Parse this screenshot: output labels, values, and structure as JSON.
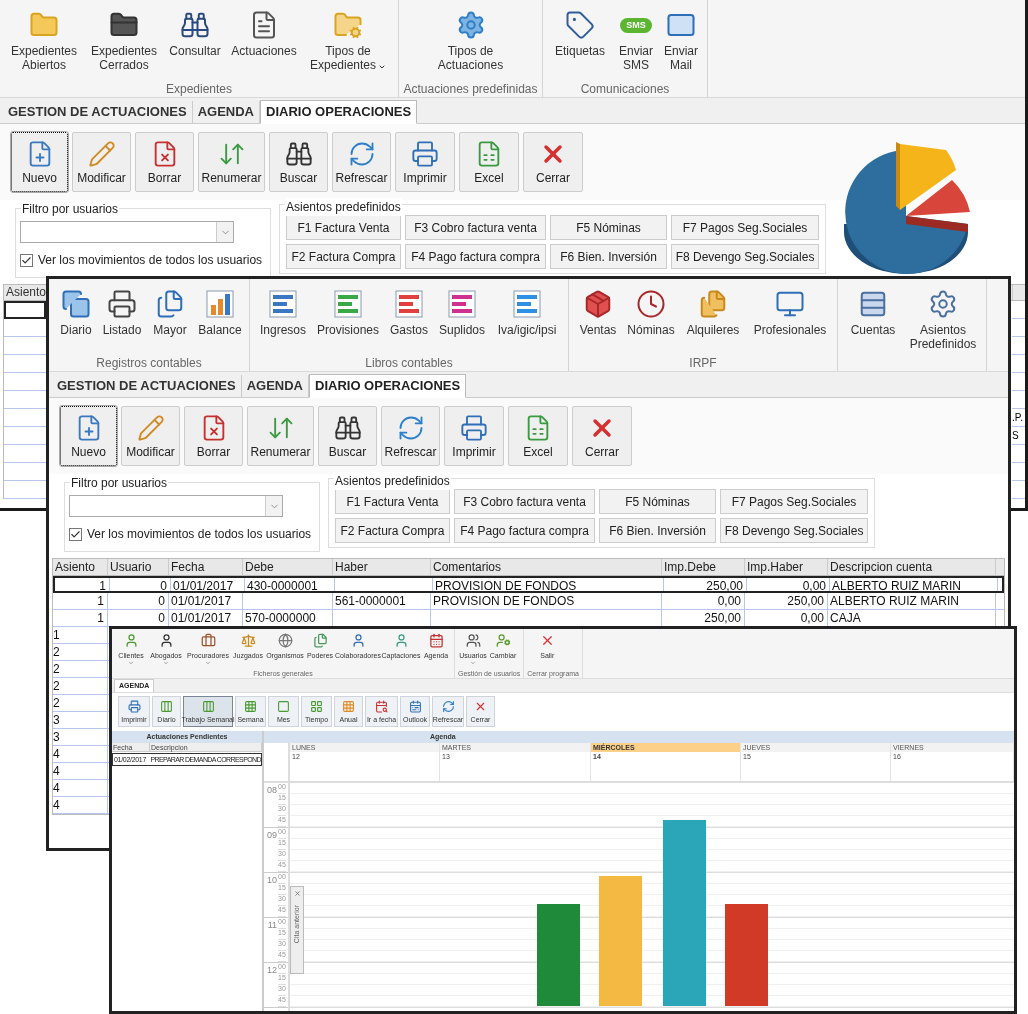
{
  "main_window": {
    "ribbon_groups": [
      {
        "label": "Expedientes",
        "buttons": [
          {
            "lines": [
              "Expedientes",
              "Abiertos"
            ],
            "dropdown": false
          },
          {
            "lines": [
              "Expedientes",
              "Cerrados"
            ],
            "dropdown": false
          },
          {
            "lines": [
              "Consultar"
            ],
            "dropdown": false
          },
          {
            "lines": [
              "Actuaciones"
            ],
            "dropdown": false
          },
          {
            "lines": [
              "Tipos de",
              "Expedientes"
            ],
            "dropdown": true
          }
        ]
      },
      {
        "label": "Actuaciones predefinidas",
        "buttons": [
          {
            "lines": [
              "Tipos de",
              "Actuaciones"
            ],
            "dropdown": false
          }
        ]
      },
      {
        "label": "Comunicaciones",
        "buttons": [
          {
            "lines": [
              "Etiquetas"
            ],
            "dropdown": false
          },
          {
            "lines": [
              "Enviar",
              "SMS"
            ],
            "dropdown": false,
            "icon_text": "SMS"
          },
          {
            "lines": [
              "Enviar",
              "Mail"
            ],
            "dropdown": false
          }
        ]
      }
    ],
    "tabs": [
      {
        "label": "GESTION DE ACTUACIONES",
        "selected": false
      },
      {
        "label": "AGENDA",
        "selected": false
      },
      {
        "label": "DIARIO OPERACIONES",
        "selected": true
      }
    ],
    "toolbar": [
      {
        "label": "Nuevo",
        "focused": true
      },
      {
        "label": "Modificar",
        "focused": false
      },
      {
        "label": "Borrar",
        "focused": false
      },
      {
        "label": "Renumerar",
        "focused": false
      },
      {
        "label": "Buscar",
        "focused": false
      },
      {
        "label": "Refrescar",
        "focused": false
      },
      {
        "label": "Imprimir",
        "focused": false
      },
      {
        "label": "Excel",
        "focused": false
      },
      {
        "label": "Cerrar",
        "focused": false
      }
    ],
    "user_filter": {
      "legend": "Filtro por usuarios",
      "checkbox": {
        "label": "Ver los movimientos de todos los usuarios",
        "checked": true
      }
    },
    "preset_entries": {
      "legend": "Asientos predefinidos",
      "buttons": [
        "F1 Factura Venta",
        "F3 Cobro factura venta",
        "F5 Nóminas",
        "F7 Pagos Seg.Sociales",
        "F2 Factura Compra",
        "F4 Pago factura compra",
        "F6 Bien. Inversión",
        "F8 Devengo Seg.Sociales"
      ]
    },
    "table": {
      "header": "Asiento",
      "rows": [
        {
          "selected": true
        },
        {
          "selected": false
        },
        {
          "selected": false
        },
        {
          "selected": false
        },
        {
          "selected": false
        },
        {
          "selected": false
        },
        {
          "selected": false,
          "edge_text": ".P."
        },
        {
          "selected": false,
          "edge_text": "S"
        },
        {
          "selected": false
        },
        {
          "selected": false
        },
        {
          "selected": false
        }
      ]
    }
  },
  "accounting_window": {
    "ribbon_groups": [
      {
        "label": "Registros contables",
        "buttons": [
          {
            "lines": [
              "Diario"
            ]
          },
          {
            "lines": [
              "Listado"
            ]
          },
          {
            "lines": [
              "Mayor"
            ]
          },
          {
            "lines": [
              "Balance"
            ]
          }
        ]
      },
      {
        "label": "Libros contables",
        "buttons": [
          {
            "lines": [
              "Ingresos"
            ]
          },
          {
            "lines": [
              "Provisiones"
            ]
          },
          {
            "lines": [
              "Gastos"
            ]
          },
          {
            "lines": [
              "Suplidos"
            ]
          },
          {
            "lines": [
              "Iva/igic/ipsi"
            ]
          }
        ]
      },
      {
        "label": "IRPF",
        "buttons": [
          {
            "lines": [
              "Ventas"
            ]
          },
          {
            "lines": [
              "Nóminas"
            ]
          },
          {
            "lines": [
              "Alquileres"
            ]
          },
          {
            "lines": [
              "Profesionales"
            ]
          }
        ]
      },
      {
        "buttons": [
          {
            "lines": [
              "Cuentas"
            ]
          },
          {
            "lines": [
              "Asientos",
              "Predefinidos"
            ]
          }
        ]
      }
    ],
    "tabs": [
      {
        "label": "GESTION DE ACTUACIONES",
        "selected": false
      },
      {
        "label": "AGENDA",
        "selected": false
      },
      {
        "label": "DIARIO OPERACIONES",
        "selected": true
      }
    ],
    "toolbar": [
      {
        "label": "Nuevo",
        "focused": true
      },
      {
        "label": "Modificar",
        "focused": false
      },
      {
        "label": "Borrar",
        "focused": false
      },
      {
        "label": "Renumerar",
        "focused": false
      },
      {
        "label": "Buscar",
        "focused": false
      },
      {
        "label": "Refrescar",
        "focused": false
      },
      {
        "label": "Imprimir",
        "focused": false
      },
      {
        "label": "Excel",
        "focused": false
      },
      {
        "label": "Cerrar",
        "focused": false
      }
    ],
    "user_filter": {
      "legend": "Filtro por usuarios",
      "checkbox": {
        "label": "Ver los movimientos de todos los usuarios",
        "checked": true
      }
    },
    "preset_entries": {
      "legend": "Asientos predefinidos",
      "buttons": [
        "F1 Factura Venta",
        "F3 Cobro factura venta",
        "F5 Nóminas",
        "F7 Pagos Seg.Sociales",
        "F2 Factura Compra",
        "F4 Pago factura compra",
        "F6 Bien. Inversión",
        "F8 Devengo Seg.Sociales"
      ]
    },
    "table": {
      "columns": [
        "Asiento",
        "Usuario",
        "Fecha",
        "Debe",
        "Haber",
        "Comentarios",
        "Imp.Debe",
        "Imp.Haber",
        "Descripcion cuenta"
      ],
      "rows": [
        {
          "selected": true,
          "cells": [
            "1",
            "0",
            "01/01/2017",
            "430-0000001",
            null,
            "PROVISION DE FONDOS",
            "250,00",
            "0,00",
            "ALBERTO RUIZ MARIN"
          ]
        },
        {
          "selected": false,
          "cells": [
            "1",
            "0",
            "01/01/2017",
            null,
            "561-0000001",
            "PROVISION DE FONDOS",
            "0,00",
            "250,00",
            "ALBERTO RUIZ MARIN"
          ]
        },
        {
          "selected": false,
          "cells": [
            "1",
            "0",
            "01/01/2017",
            "570-0000000",
            null,
            null,
            "250,00",
            "0,00",
            "CAJA"
          ]
        },
        {
          "selected": false,
          "cells": [
            "1"
          ]
        },
        {
          "selected": false,
          "cells": [
            "2"
          ]
        },
        {
          "selected": false,
          "cells": [
            "2"
          ]
        },
        {
          "selected": false,
          "cells": [
            "2"
          ]
        },
        {
          "selected": false,
          "cells": [
            "2"
          ]
        },
        {
          "selected": false,
          "cells": [
            "3"
          ]
        },
        {
          "selected": false,
          "cells": [
            "3"
          ]
        },
        {
          "selected": false,
          "cells": [
            "4"
          ]
        },
        {
          "selected": false,
          "cells": [
            "4"
          ]
        },
        {
          "selected": false,
          "cells": [
            "4"
          ]
        },
        {
          "selected": false,
          "cells": [
            "4"
          ]
        }
      ]
    }
  },
  "agenda_window": {
    "ribbon_groups": [
      {
        "label": "Ficheros generales",
        "buttons": [
          {
            "label": "Clientes",
            "dropdown": true
          },
          {
            "label": "Abogados",
            "dropdown": true
          },
          {
            "label": "Procuradores",
            "dropdown": true
          },
          {
            "label": "Juzgados",
            "dropdown": false
          },
          {
            "label": "Organismos",
            "dropdown": false
          },
          {
            "label": "Poderes",
            "dropdown": false
          },
          {
            "label": "Colaboradores",
            "dropdown": false
          },
          {
            "label": "Captaciones",
            "dropdown": false
          },
          {
            "label": "Agenda",
            "dropdown": false
          }
        ]
      },
      {
        "label": "Gestión de usuarios",
        "buttons": [
          {
            "label": "Usuarios",
            "dropdown": true
          },
          {
            "label": "Cambiar",
            "dropdown": false
          }
        ]
      },
      {
        "label": "Cerrar programa",
        "buttons": [
          {
            "label": "Salir",
            "dropdown": false
          }
        ]
      }
    ],
    "tabs": [
      {
        "label": "AGENDA",
        "selected": true
      }
    ],
    "toolbar": [
      {
        "label": "Imprimir",
        "selected": false
      },
      {
        "label": "Diario",
        "selected": false
      },
      {
        "label": "Trabajo Semanal",
        "selected": true
      },
      {
        "label": "Semana",
        "selected": false
      },
      {
        "label": "Mes",
        "selected": false
      },
      {
        "label": "Tiempo",
        "selected": false
      },
      {
        "label": "Anual",
        "selected": false
      },
      {
        "label": "Ir a fecha",
        "selected": false
      },
      {
        "label": "Outlook",
        "selected": false
      },
      {
        "label": "Refrescar",
        "selected": false
      },
      {
        "label": "Cerrar",
        "selected": false
      }
    ],
    "pending": {
      "title": "Actuaciones Pendientes",
      "columns": [
        "Fecha",
        "Descripcion"
      ],
      "rows": [
        {
          "selected": true,
          "cells": [
            "01/02/2017",
            "PREPARAR DEMANDA CORRESPOND"
          ]
        }
      ]
    },
    "calendar": {
      "title": "Agenda",
      "days": [
        {
          "name": "LUNES",
          "date": "12",
          "today": false
        },
        {
          "name": "MARTES",
          "date": "13",
          "today": false
        },
        {
          "name": "MIÉRCOLES",
          "date": "14",
          "today": true
        },
        {
          "name": "JUEVES",
          "date": "15",
          "today": false
        },
        {
          "name": "VIERNES",
          "date": "16",
          "today": false
        }
      ],
      "hours": [
        {
          "hour": "08",
          "quarters": [
            "00",
            "15",
            "30",
            "45"
          ]
        },
        {
          "hour": "09",
          "quarters": [
            "00",
            "15",
            "30",
            "45"
          ]
        },
        {
          "hour": "10",
          "quarters": [
            "00",
            "15",
            "30",
            "45"
          ]
        },
        {
          "hour": "11",
          "quarters": [
            "00",
            "15",
            "30",
            "45"
          ]
        },
        {
          "hour": "12",
          "quarters": [
            "00",
            "15",
            "30",
            "45"
          ]
        }
      ],
      "reminder_tab": {
        "label": "Cita anterior"
      }
    }
  }
}
